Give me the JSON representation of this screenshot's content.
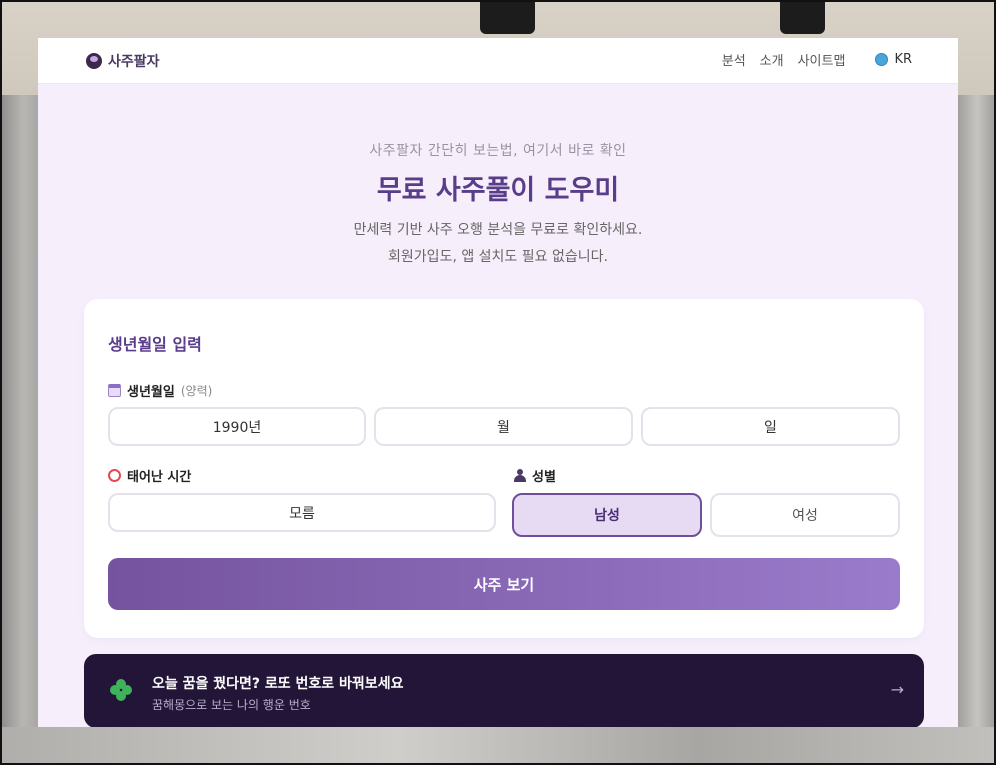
{
  "nav": {
    "brand": "사주팔자",
    "links": [
      "분석",
      "소개",
      "사이트맵"
    ],
    "language": "KR"
  },
  "hero": {
    "subtitle": "사주팔자 간단히 보는법, 여기서 바로 확인",
    "title": "무료 사주풀이 도우미",
    "desc_line1": "만세력 기반 사주 오행 분석을 무료로 확인하세요.",
    "desc_line2": "회원가입도, 앱 설치도 필요 없습니다."
  },
  "form": {
    "title": "생년월일 입력",
    "birth_label": "생년월일",
    "birth_hint": "(양력)",
    "year_value": "1990년",
    "month_value": "월",
    "day_value": "일",
    "time_label": "태어난 시간",
    "time_value": "모름",
    "gender_label": "성별",
    "gender_male": "남성",
    "gender_female": "여성",
    "gender_selected": "남성",
    "submit_label": "사주 보기"
  },
  "promo": {
    "title": "오늘 꿈을 꿨다면? 로또 번호로 바꿔보세요",
    "subtitle": "꿈해몽으로 보는 나의 행운 번호",
    "arrow": "→"
  },
  "colors": {
    "accent": "#5a3d8a",
    "page_bg": "#f6effb",
    "promo_bg": "#221537"
  }
}
